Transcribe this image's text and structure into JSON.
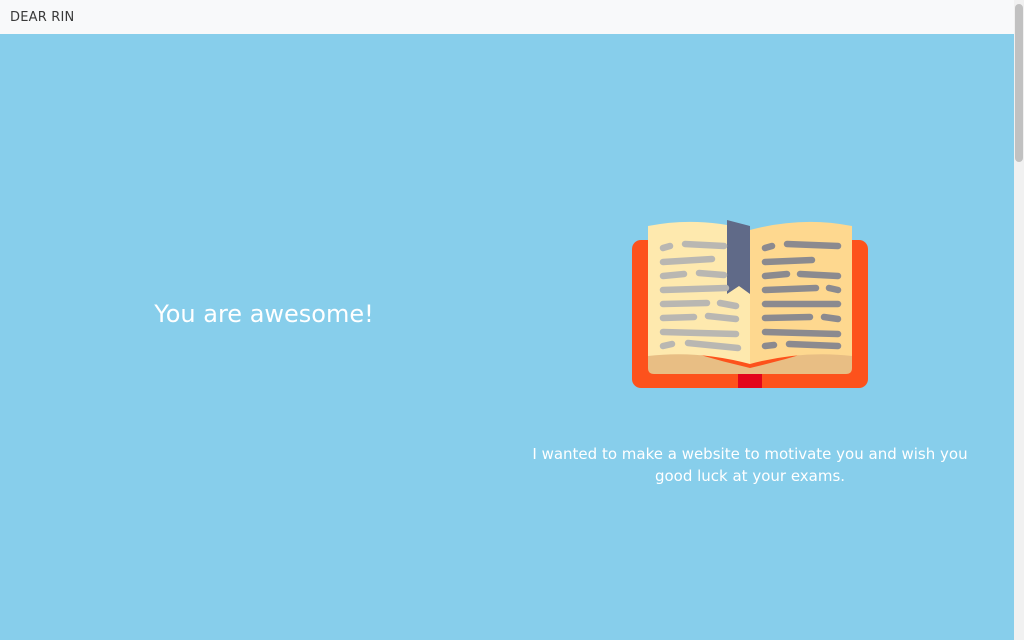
{
  "nav": {
    "brand": "DEAR RIN"
  },
  "hero": {
    "headline": "You are awesome!",
    "message": "I wanted to make a website to motivate you and wish you good luck at your exams.",
    "illustration": "open-book-icon"
  },
  "colors": {
    "background": "#87ceeb",
    "navbar": "#f8f9fa",
    "text": "#ffffff",
    "book_cover": "#fd521c",
    "pages": "#fee9ae",
    "bookmark": "#606a88"
  }
}
